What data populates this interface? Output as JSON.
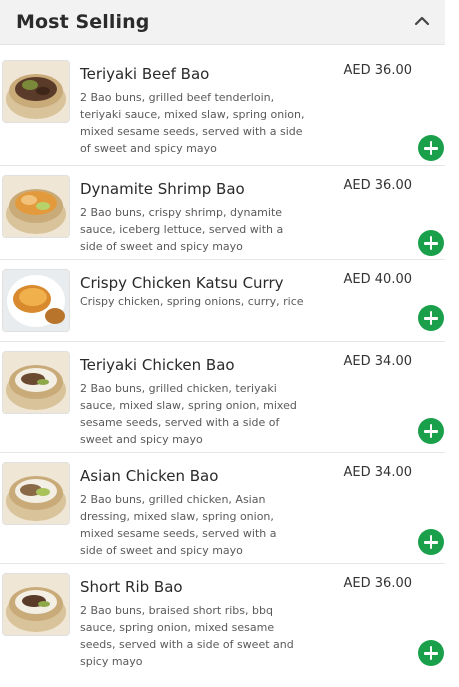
{
  "section": {
    "title": "Most Selling",
    "collapse_icon": "chevron-up-icon"
  },
  "colors": {
    "accent": "#1aa04b",
    "header_bg": "#f2f2f2"
  },
  "items": [
    {
      "name": "Teriyaki Beef Bao",
      "price": "AED 36.00",
      "description": "2 Bao buns, grilled beef tenderloin, teriyaki sauce, mixed slaw, spring onion, mixed sesame seeds, served with a side of sweet and spicy mayo"
    },
    {
      "name": "Dynamite Shrimp Bao",
      "price": "AED 36.00",
      "description": "2 Bao buns, crispy shrimp, dynamite sauce, iceberg lettuce, served with a side of sweet and spicy mayo"
    },
    {
      "name": "Crispy Chicken Katsu Curry",
      "price": "AED 40.00",
      "description": "Crispy chicken, spring onions, curry, rice"
    },
    {
      "name": "Teriyaki Chicken Bao",
      "price": "AED 34.00",
      "description": "2 Bao buns, grilled chicken, teriyaki sauce, mixed slaw, spring onion, mixed sesame seeds, served with a side of sweet and spicy mayo"
    },
    {
      "name": "Asian Chicken Bao",
      "price": "AED 34.00",
      "description": "2 Bao buns, grilled chicken, Asian dressing, mixed slaw, spring onion, mixed sesame seeds, served with a side of sweet and spicy mayo"
    },
    {
      "name": "Short Rib Bao",
      "price": "AED 36.00",
      "description": "2 Bao buns, braised short ribs, bbq sauce, spring onion, mixed sesame seeds, served with a side of sweet and spicy mayo"
    }
  ]
}
